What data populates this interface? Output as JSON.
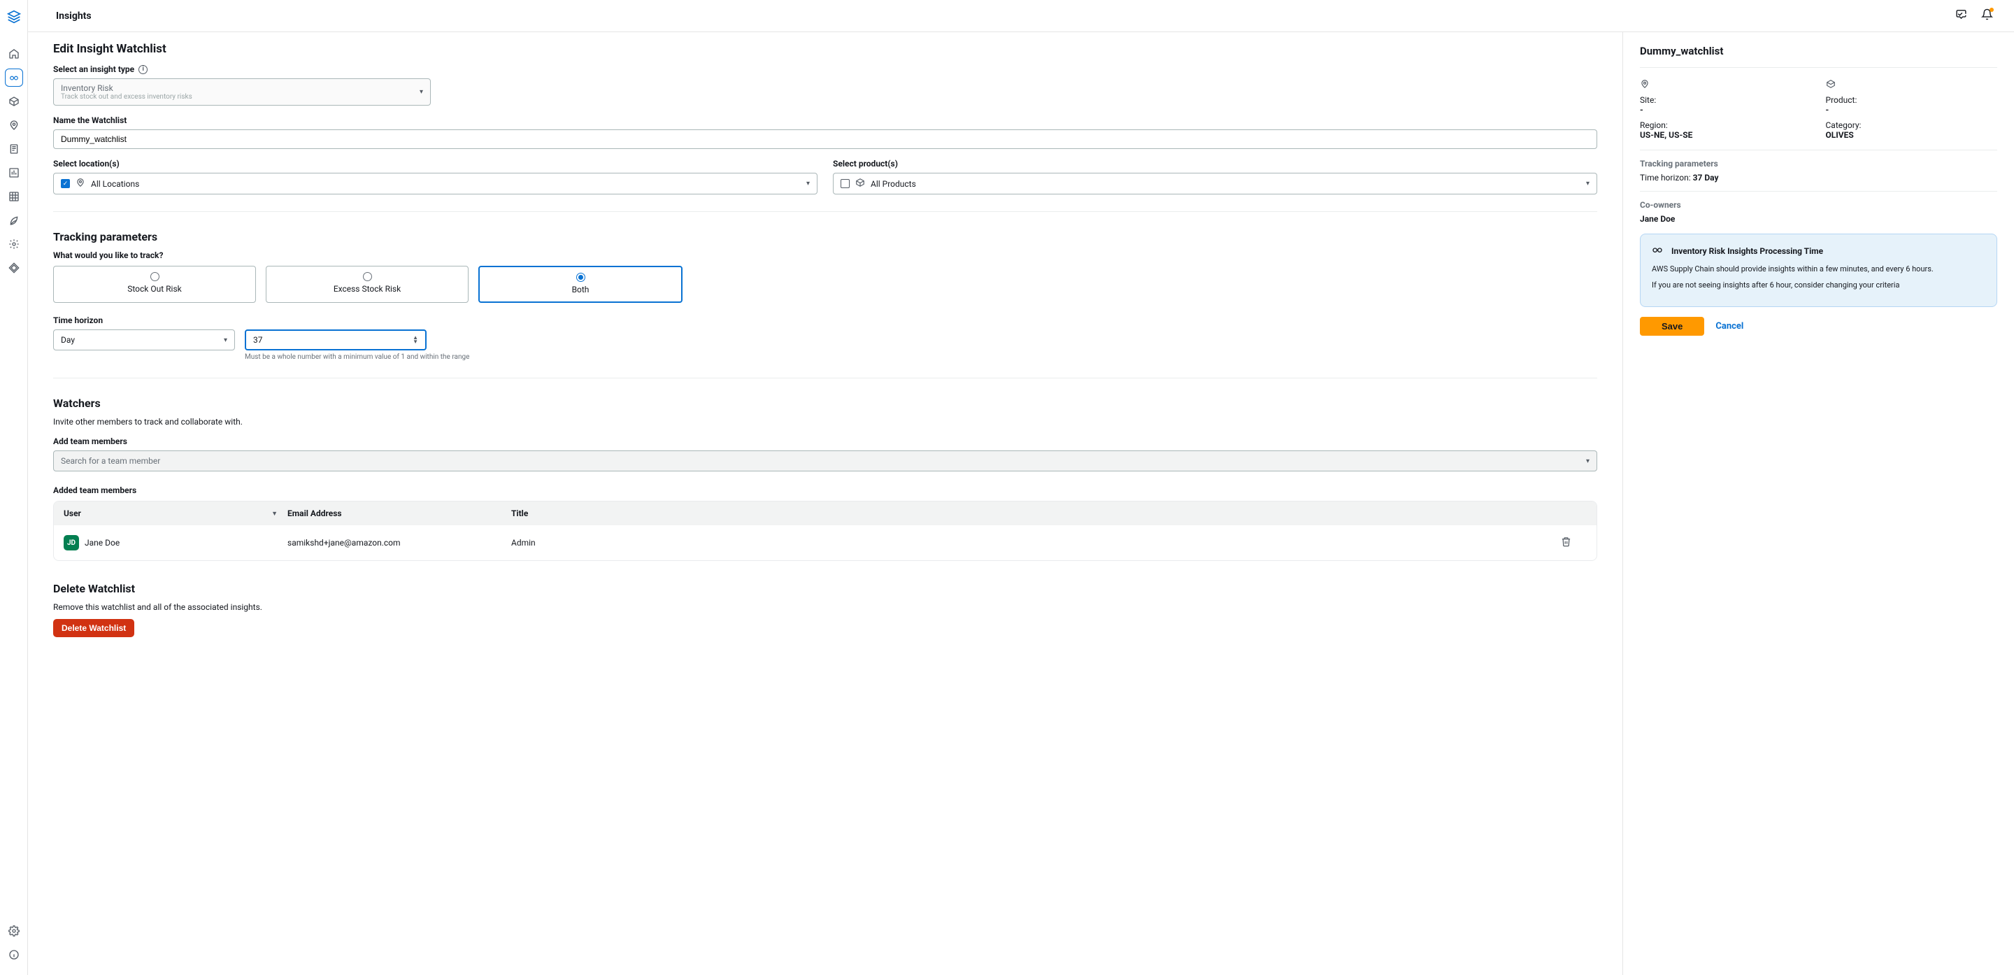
{
  "header": {
    "title": "Insights"
  },
  "page": {
    "heading": "Edit Insight Watchlist",
    "selectInsightLabel": "Select an insight type",
    "insightType": {
      "title": "Inventory Risk",
      "description": "Track stock out and excess inventory risks"
    },
    "nameLabel": "Name the Watchlist",
    "nameValue": "Dummy_watchlist",
    "locationsLabel": "Select location(s)",
    "allLocations": "All Locations",
    "productsLabel": "Select product(s)",
    "allProducts": "All Products",
    "tracking": {
      "heading": "Tracking parameters",
      "question": "What would you like to track?",
      "options": [
        "Stock Out Risk",
        "Excess Stock Risk",
        "Both"
      ],
      "selectedIndex": 2,
      "timeHorizonLabel": "Time horizon",
      "unit": "Day",
      "value": "37",
      "hint": "Must be a whole number with a minimum value of 1 and within the range"
    },
    "watchers": {
      "heading": "Watchers",
      "description": "Invite other members to track and collaborate with.",
      "addLabel": "Add team members",
      "placeholder": "Search for a team member",
      "addedLabel": "Added team members",
      "columns": {
        "user": "User",
        "email": "Email Address",
        "title": "Title"
      },
      "member": {
        "initials": "JD",
        "name": "Jane Doe",
        "email": "samikshd+jane@amazon.com",
        "title": "Admin"
      }
    },
    "deleteSection": {
      "heading": "Delete Watchlist",
      "description": "Remove this watchlist and all of the associated insights.",
      "button": "Delete Watchlist"
    }
  },
  "panel": {
    "title": "Dummy_watchlist",
    "siteLabel": "Site:",
    "siteValue": "-",
    "regionLabel": "Region:",
    "regionValue": "US-NE, US-SE",
    "productLabel": "Product:",
    "productValue": "-",
    "categoryLabel": "Category:",
    "categoryValue": "OLIVES",
    "trackingTitle": "Tracking parameters",
    "timeHorizonLabel": "Time horizon:",
    "timeHorizonValue": "37 Day",
    "coownersTitle": "Co-owners",
    "coowner": "Jane Doe",
    "info": {
      "title": "Inventory Risk Insights Processing Time",
      "line1": "AWS Supply Chain should provide insights within a few minutes, and every 6 hours.",
      "line2": "If you are not seeing insights after 6 hour, consider changing your criteria"
    },
    "save": "Save",
    "cancel": "Cancel"
  }
}
